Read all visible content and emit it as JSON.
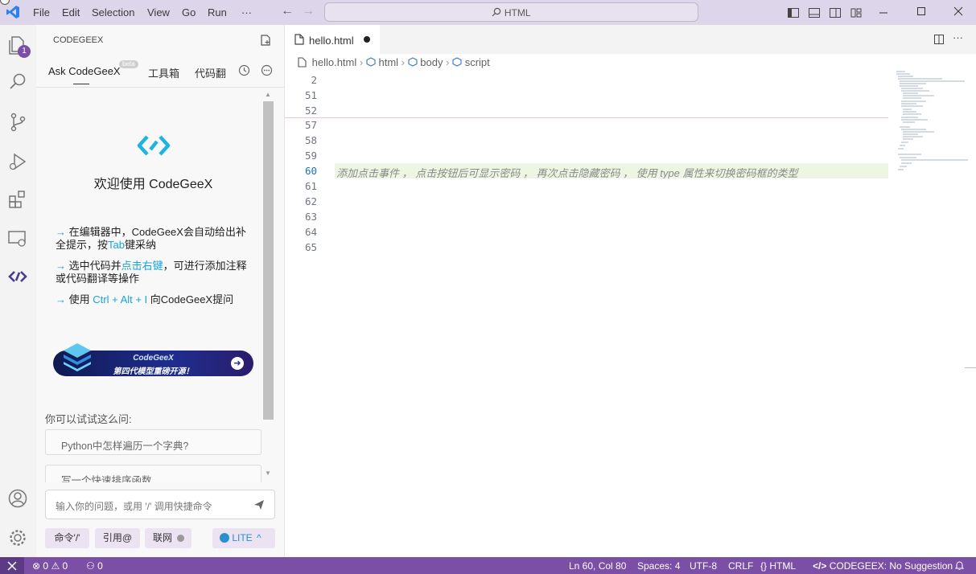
{
  "menu": [
    "File",
    "Edit",
    "Selection",
    "View",
    "Go",
    "Run",
    "···"
  ],
  "search": {
    "label": "HTML"
  },
  "activity": {
    "explorer_badge": "1"
  },
  "side": {
    "title": "CODEGEEX",
    "tabs": [
      "Ask CodeGeeX",
      "工具箱",
      "代码翻"
    ],
    "beta_badge": "beta",
    "welcome_title": "欢迎使用 CodeGeeX",
    "tips": [
      {
        "a": "在编辑器中，CodeGeeX会自动给出补全提示，按",
        "hl": "Tab",
        "b": "键采纳"
      },
      {
        "a": "选中代码并",
        "hl": "点击右键",
        "b": "，可进行添加注释或代码翻译等操作"
      },
      {
        "a": "使用 ",
        "hl": "Ctrl + Alt + I",
        "b": " 向CodeGeeX提问"
      }
    ],
    "banner_line1": "CodeGeeX",
    "banner_line2": "第四代模型重磅开源！",
    "try_label": "你可以试试这么问:",
    "suggestions": [
      "Python中怎样遍历一个字典?",
      "写一个快速排序函数"
    ],
    "input_placeholder": "输入你的问题，或用 '/' 调用快捷命令",
    "chips": [
      "命令'/'",
      "引用@",
      "联网"
    ],
    "lite_label": "LITE"
  },
  "editor": {
    "tab_name": "hello.html",
    "breadcrumb": [
      "hello.html",
      "html",
      "body",
      "script"
    ],
    "line_numbers": [
      "2",
      "51",
      "52",
      "57",
      "58",
      "59",
      "60",
      "61",
      "62",
      "63",
      "64",
      "65"
    ],
    "ghost_text": "添加点击事件 ， 点击按钮后可显示密码 ， 再次点击隐藏密码 ， 使用 type 属性来切换密码框的类型"
  },
  "status": {
    "errors": "0",
    "warnings": "0",
    "ports": "0",
    "position": "Ln 60, Col 80",
    "spaces": "Spaces: 4",
    "encoding": "UTF-8",
    "eol": "CRLF",
    "language": "HTML",
    "codegeex": "CODEGEEX: No Suggestion"
  },
  "colors": {
    "accent": "#7b4fa6",
    "brand": "#1fb3e0",
    "highlight": "#16a4d8"
  }
}
